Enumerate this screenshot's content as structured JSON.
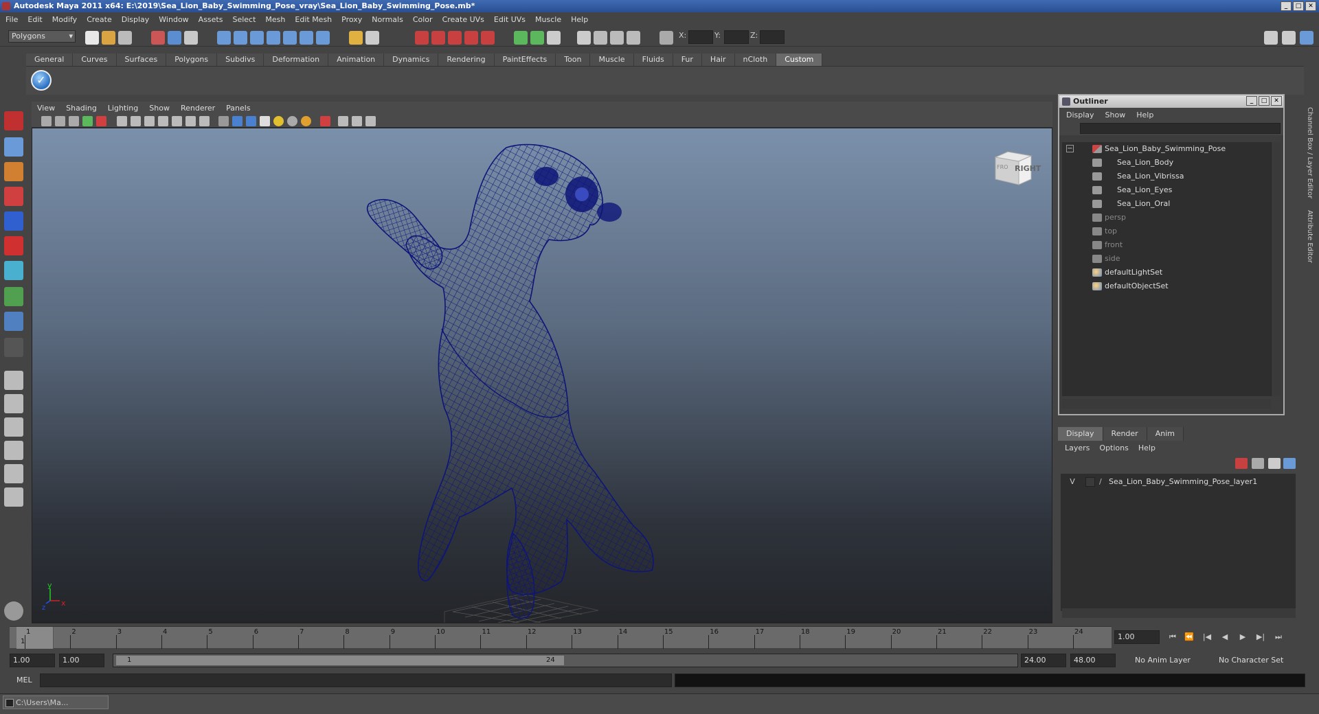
{
  "window": {
    "title": "Autodesk Maya 2011 x64: E:\\2019\\Sea_Lion_Baby_Swimming_Pose_vray\\Sea_Lion_Baby_Swimming_Pose.mb*",
    "min": "_",
    "max": "□",
    "close": "✕"
  },
  "menubar": [
    "File",
    "Edit",
    "Modify",
    "Create",
    "Display",
    "Window",
    "Assets",
    "Select",
    "Mesh",
    "Edit Mesh",
    "Proxy",
    "Normals",
    "Color",
    "Create UVs",
    "Edit UVs",
    "Muscle",
    "Help"
  ],
  "statusline": {
    "mode": "Polygons",
    "x_label": "X:",
    "y_label": "Y:",
    "z_label": "Z:"
  },
  "shelf": {
    "tabs": [
      "General",
      "Curves",
      "Surfaces",
      "Polygons",
      "Subdivs",
      "Deformation",
      "Animation",
      "Dynamics",
      "Rendering",
      "PaintEffects",
      "Toon",
      "Muscle",
      "Fluids",
      "Fur",
      "Hair",
      "nCloth",
      "Custom"
    ],
    "active_tab": "Custom",
    "icon_glyph": "✓"
  },
  "viewport": {
    "menu": [
      "View",
      "Shading",
      "Lighting",
      "Show",
      "Renderer",
      "Panels"
    ],
    "viewcube_label": "RIGHT",
    "viewcube_small": "FRO",
    "axis_y": "y",
    "axis_x": "x",
    "axis_z": "z",
    "colors": {
      "wire": "#0e1578",
      "axis_x": "#d42020",
      "axis_y": "#20d020",
      "axis_z": "#2050ff"
    }
  },
  "outliner": {
    "title": "Outliner",
    "menu": [
      "Display",
      "Show",
      "Help"
    ],
    "expand_glyph": "−",
    "items": [
      {
        "label": "Sea_Lion_Baby_Swimming_Pose",
        "indent": 0,
        "icon": "group-icon",
        "dim": false
      },
      {
        "label": "Sea_Lion_Body",
        "indent": 1,
        "icon": "mesh-icon",
        "dim": false
      },
      {
        "label": "Sea_Lion_Vibrissa",
        "indent": 1,
        "icon": "mesh-icon",
        "dim": false
      },
      {
        "label": "Sea_Lion_Eyes",
        "indent": 1,
        "icon": "mesh-icon",
        "dim": false
      },
      {
        "label": "Sea_Lion_Oral",
        "indent": 1,
        "icon": "mesh-icon",
        "dim": false
      },
      {
        "label": "persp",
        "indent": 0,
        "icon": "camera-icon",
        "dim": true
      },
      {
        "label": "top",
        "indent": 0,
        "icon": "camera-icon",
        "dim": true
      },
      {
        "label": "front",
        "indent": 0,
        "icon": "camera-icon",
        "dim": true
      },
      {
        "label": "side",
        "indent": 0,
        "icon": "camera-icon",
        "dim": true
      },
      {
        "label": "defaultLightSet",
        "indent": 0,
        "icon": "set-icon",
        "dim": false
      },
      {
        "label": "defaultObjectSet",
        "indent": 0,
        "icon": "set-icon",
        "dim": false
      }
    ]
  },
  "layers": {
    "tabs": [
      "Display",
      "Render",
      "Anim"
    ],
    "active_tab": "Display",
    "menu": [
      "Layers",
      "Options",
      "Help"
    ],
    "rows": [
      {
        "visible": "V",
        "slash": "/",
        "name": "Sea_Lion_Baby_Swimming_Pose_layer1"
      }
    ]
  },
  "side_tabs": [
    "Channel Box / Layer Editor",
    "Attribute Editor"
  ],
  "timeline": {
    "ticks": [
      "1",
      "2",
      "3",
      "4",
      "5",
      "6",
      "7",
      "8",
      "9",
      "10",
      "11",
      "12",
      "13",
      "14",
      "15",
      "16",
      "17",
      "18",
      "19",
      "20",
      "21",
      "22",
      "23",
      "24"
    ],
    "current_frame": "1",
    "current_time": "1.00",
    "playback": [
      "⏮",
      "⏪",
      "|◀",
      "◀",
      "▶",
      "▶|",
      "⏭"
    ]
  },
  "range": {
    "start": "1.00",
    "start2": "1.00",
    "slider_start": "1",
    "slider_end": "24",
    "end": "24.00",
    "end2": "48.00",
    "anim_layer": "No Anim Layer",
    "char_set": "No Character Set"
  },
  "cmdline": {
    "label": "MEL"
  },
  "taskbar": {
    "item": "C:\\Users\\Ma..."
  }
}
